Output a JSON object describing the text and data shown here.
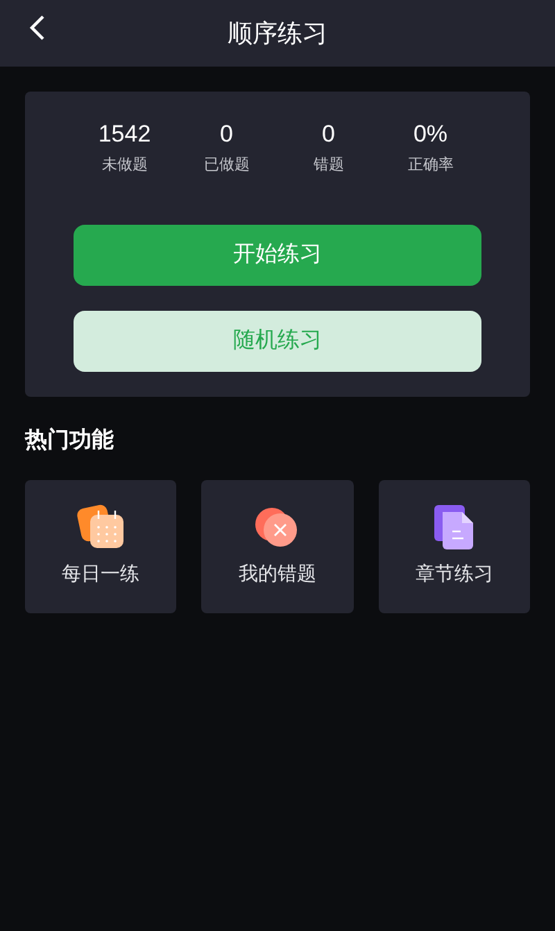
{
  "header": {
    "title": "顺序练习"
  },
  "stats": [
    {
      "value": "1542",
      "label": "未做题"
    },
    {
      "value": "0",
      "label": "已做题"
    },
    {
      "value": "0",
      "label": "错题"
    },
    {
      "value": "0%",
      "label": "正确率"
    }
  ],
  "buttons": [
    {
      "label": "开始练习",
      "kind": "primary"
    },
    {
      "label": "随机练习",
      "kind": "secondary"
    }
  ],
  "section": {
    "title": "热门功能"
  },
  "features": [
    {
      "label": "每日一练",
      "kind": "calendar"
    },
    {
      "label": "我的错题",
      "kind": "wrong"
    },
    {
      "label": "章节练习",
      "kind": "document"
    }
  ]
}
